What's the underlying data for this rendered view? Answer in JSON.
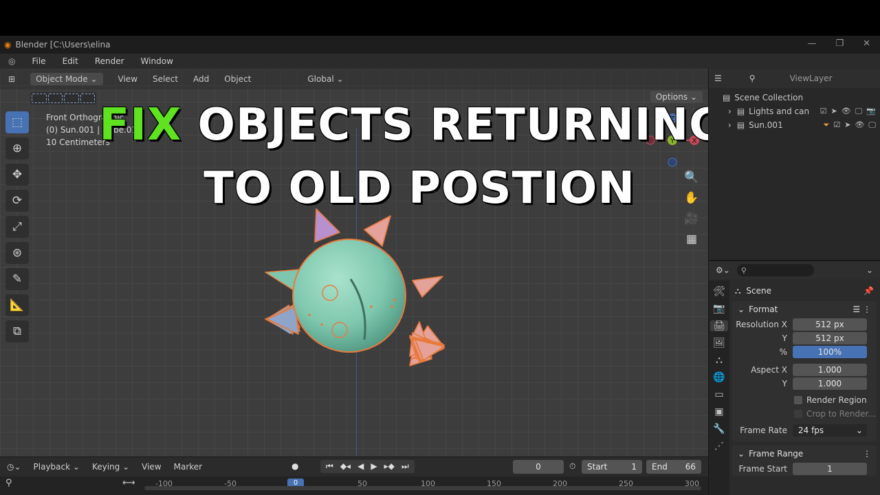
{
  "headline": {
    "word1": "FIX",
    "rest1": " OBJECTS RETURNING",
    "line2": "TO OLD POSTION"
  },
  "window": {
    "title": "Blender [C:\\Users\\elina"
  },
  "menu": [
    "File",
    "Edit",
    "Render",
    "Window"
  ],
  "viewport_header": {
    "mode": "Object Mode",
    "items": [
      "View",
      "Select",
      "Add",
      "Object"
    ],
    "transform": "Global",
    "options": "Options"
  },
  "viewport_info": {
    "view": "Front Orthographic",
    "object": "(0) Sun.001 | Cube.013",
    "scale": "10 Centimeters"
  },
  "gizmo": {
    "x": "X",
    "y": "Y",
    "z": "Z"
  },
  "outliner": {
    "view_layer": "ViewLayer",
    "collection": "Scene Collection",
    "items": [
      {
        "name": "Lights and can"
      },
      {
        "name": "Sun.001"
      }
    ]
  },
  "properties": {
    "scene": "Scene",
    "format_title": "Format",
    "resolution_x_label": "Resolution X",
    "resolution_x": "512 px",
    "resolution_y_label": "Y",
    "resolution_y": "512 px",
    "percent_label": "%",
    "percent": "100%",
    "aspect_x_label": "Aspect X",
    "aspect_x": "1.000",
    "aspect_y_label": "Y",
    "aspect_y": "1.000",
    "render_region": "Render Region",
    "crop": "Crop to Render...",
    "frame_rate_label": "Frame Rate",
    "frame_rate": "24 fps",
    "frame_range_title": "Frame Range",
    "frame_start_label": "Frame Start",
    "frame_start": "1"
  },
  "timeline": {
    "menus": [
      "Playback",
      "Keying",
      "View",
      "Marker"
    ],
    "current_frame": "0",
    "start_label": "Start",
    "start": "1",
    "end_label": "End",
    "end": "66",
    "playhead": "0",
    "ruler": [
      "-100",
      "-50",
      "50",
      "100",
      "150",
      "200",
      "250",
      "300"
    ]
  },
  "colors": {
    "accent": "#4772b3",
    "fix_green": "#5fe21f",
    "sun_body": "#7ec7ae",
    "outline": "#e87a3c"
  }
}
